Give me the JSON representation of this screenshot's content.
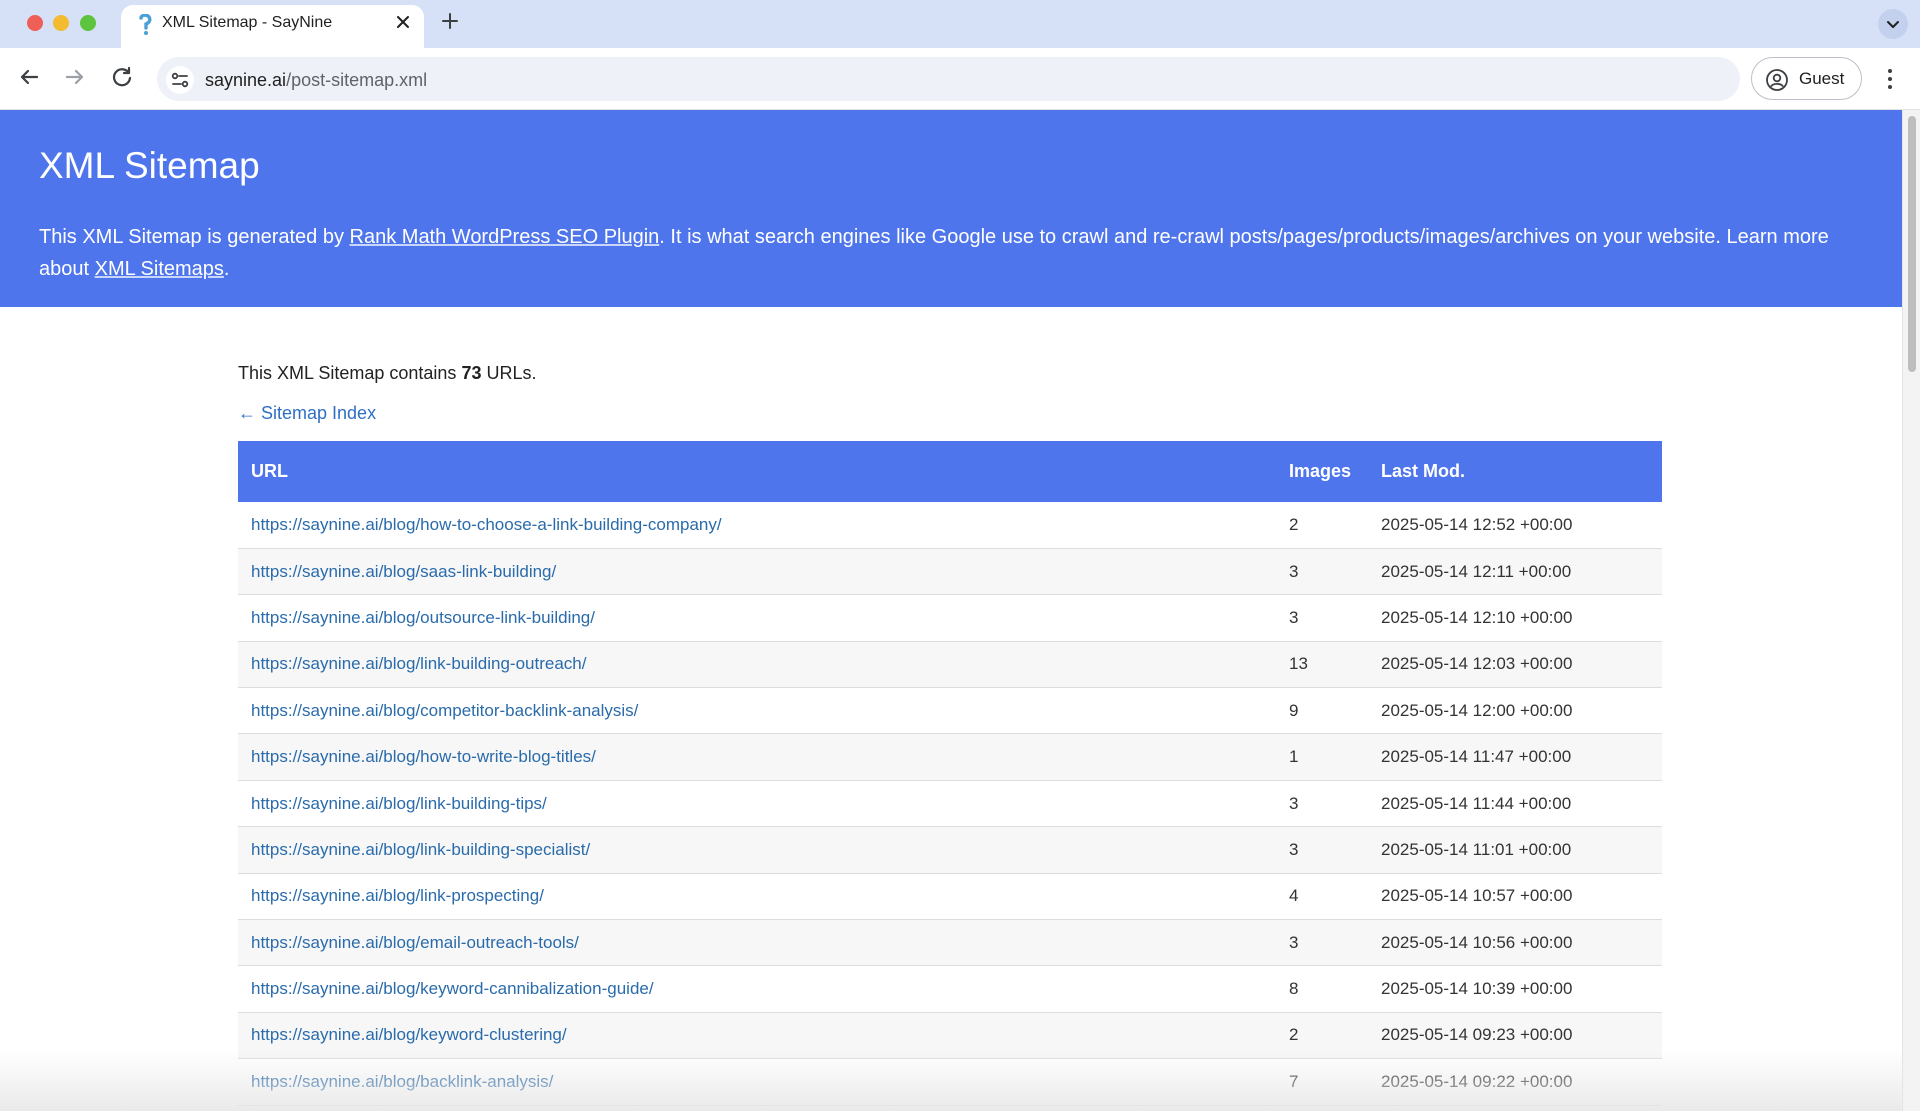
{
  "browser": {
    "tab_title": "XML Sitemap - SayNine",
    "url_host": "saynine.ai",
    "url_path": "/post-sitemap.xml",
    "profile_label": "Guest"
  },
  "banner": {
    "title": "XML Sitemap",
    "text_before_link": "This XML Sitemap is generated by ",
    "plugin_link": "Rank Math WordPress SEO Plugin",
    "text_after_link": ". It is what search engines like Google use to crawl and re-crawl posts/pages/products/images/archives on your website. Learn more about ",
    "sitemaps_link": "XML Sitemaps",
    "text_end": "."
  },
  "summary": {
    "prefix": "This XML Sitemap contains ",
    "count": "73",
    "suffix": " URLs."
  },
  "index_link": "← Sitemap Index",
  "table": {
    "headers": {
      "url": "URL",
      "images": "Images",
      "lastmod": "Last Mod."
    },
    "rows": [
      {
        "url": "https://saynine.ai/blog/how-to-choose-a-link-building-company/",
        "images": "2",
        "lastmod": "2025-05-14 12:52 +00:00"
      },
      {
        "url": "https://saynine.ai/blog/saas-link-building/",
        "images": "3",
        "lastmod": "2025-05-14 12:11 +00:00"
      },
      {
        "url": "https://saynine.ai/blog/outsource-link-building/",
        "images": "3",
        "lastmod": "2025-05-14 12:10 +00:00"
      },
      {
        "url": "https://saynine.ai/blog/link-building-outreach/",
        "images": "13",
        "lastmod": "2025-05-14 12:03 +00:00"
      },
      {
        "url": "https://saynine.ai/blog/competitor-backlink-analysis/",
        "images": "9",
        "lastmod": "2025-05-14 12:00 +00:00"
      },
      {
        "url": "https://saynine.ai/blog/how-to-write-blog-titles/",
        "images": "1",
        "lastmod": "2025-05-14 11:47 +00:00"
      },
      {
        "url": "https://saynine.ai/blog/link-building-tips/",
        "images": "3",
        "lastmod": "2025-05-14 11:44 +00:00"
      },
      {
        "url": "https://saynine.ai/blog/link-building-specialist/",
        "images": "3",
        "lastmod": "2025-05-14 11:01 +00:00"
      },
      {
        "url": "https://saynine.ai/blog/link-prospecting/",
        "images": "4",
        "lastmod": "2025-05-14 10:57 +00:00"
      },
      {
        "url": "https://saynine.ai/blog/email-outreach-tools/",
        "images": "3",
        "lastmod": "2025-05-14 10:56 +00:00"
      },
      {
        "url": "https://saynine.ai/blog/keyword-cannibalization-guide/",
        "images": "8",
        "lastmod": "2025-05-14 10:39 +00:00"
      },
      {
        "url": "https://saynine.ai/blog/keyword-clustering/",
        "images": "2",
        "lastmod": "2025-05-14 09:23 +00:00"
      },
      {
        "url": "https://saynine.ai/blog/backlink-analysis/",
        "images": "7",
        "lastmod": "2025-05-14 09:22 +00:00"
      }
    ]
  },
  "colors": {
    "banner": "#4e75eb",
    "link": "#2a6bab",
    "tabstrip": "#d6e1f7"
  }
}
